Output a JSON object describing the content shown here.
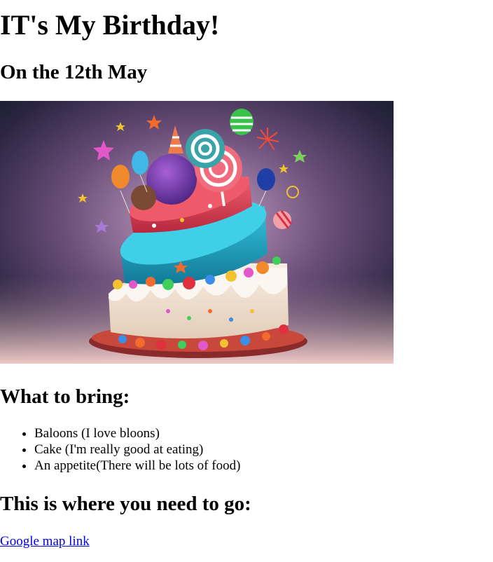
{
  "page": {
    "title": "IT's My Birthday!",
    "date_heading": "On the 12th May",
    "image_alt": "Colorful tilted birthday cake with balloons, lollipops and candy"
  },
  "bring": {
    "heading": "What to bring:",
    "items": [
      "Baloons (I love bloons)",
      "Cake (I'm really good at eating)",
      "An appetite(There will be lots of food)"
    ]
  },
  "directions": {
    "heading": "This is where you need to go:",
    "link_text": "Google map link"
  },
  "colors": {
    "link": "#0000ee",
    "text": "#000000",
    "background": "#ffffff"
  }
}
